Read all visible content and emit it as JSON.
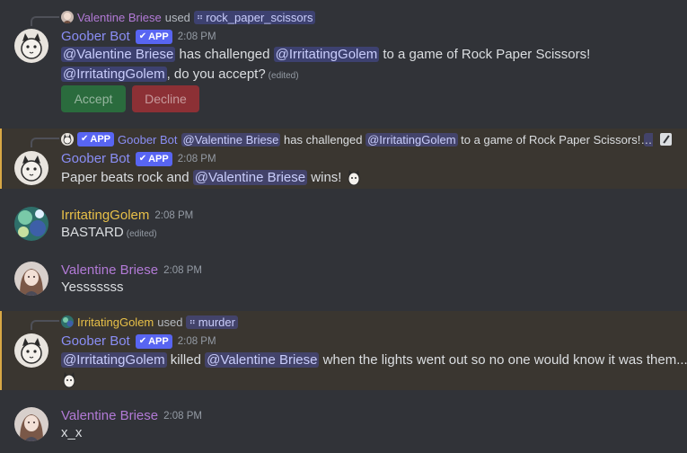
{
  "messages": [
    {
      "reply": {
        "user": "Valentine Briese",
        "verb": "used",
        "command": "rock_paper_scissors"
      },
      "author": "Goober Bot",
      "app_tag": "APP",
      "time": "2:08 PM",
      "parts": {
        "m1": "@Valentine Briese",
        "t1": " has challenged ",
        "m2": "@IrritatingGolem",
        "t2": " to a game of Rock Paper Scissors!",
        "m3": "@IrritatingGolem",
        "t3": ", do you accept?",
        "edited": "(edited)"
      },
      "buttons": {
        "accept": "Accept",
        "decline": "Decline"
      }
    },
    {
      "reply": {
        "app_tag": "APP",
        "user": "Goober Bot",
        "m1": "@Valentine Briese",
        "t1": " has challenged ",
        "m2": "@IrritatingGolem",
        "t2": " to a game of Rock Paper Scissors! ",
        "m3": "@Ir..."
      },
      "author": "Goober Bot",
      "app_tag": "APP",
      "time": "2:08 PM",
      "parts": {
        "t1": "Paper beats rock and ",
        "m1": "@Valentine Briese",
        "t2": " wins!"
      }
    },
    {
      "author": "IrritatingGolem",
      "time": "2:08 PM",
      "text": "BASTARD",
      "edited": "(edited)"
    },
    {
      "author": "Valentine Briese",
      "time": "2:08 PM",
      "text": "Yesssssss"
    },
    {
      "reply": {
        "user": "IrritatingGolem",
        "verb": "used",
        "command": "murder"
      },
      "author": "Goober Bot",
      "app_tag": "APP",
      "time": "2:08 PM",
      "parts": {
        "m1": "@IrritatingGolem",
        "t1": " killed ",
        "m2": "@Valentine Briese",
        "t2": " when the lights went out so no one would know it was them..."
      }
    },
    {
      "author": "Valentine Briese",
      "time": "2:08 PM",
      "text": "x_x"
    }
  ],
  "icons": {
    "command": "slash-command-icon",
    "verified": "check-icon",
    "edit": "pencil-icon",
    "emoji": "cat-emoji-icon"
  },
  "colors": {
    "bot_name": "#8a8ef5",
    "valentine_name": "#b27ad6",
    "golem_name": "#e8c048",
    "mention_bg": "#4a4f8c",
    "highlight": "#d8a845"
  }
}
